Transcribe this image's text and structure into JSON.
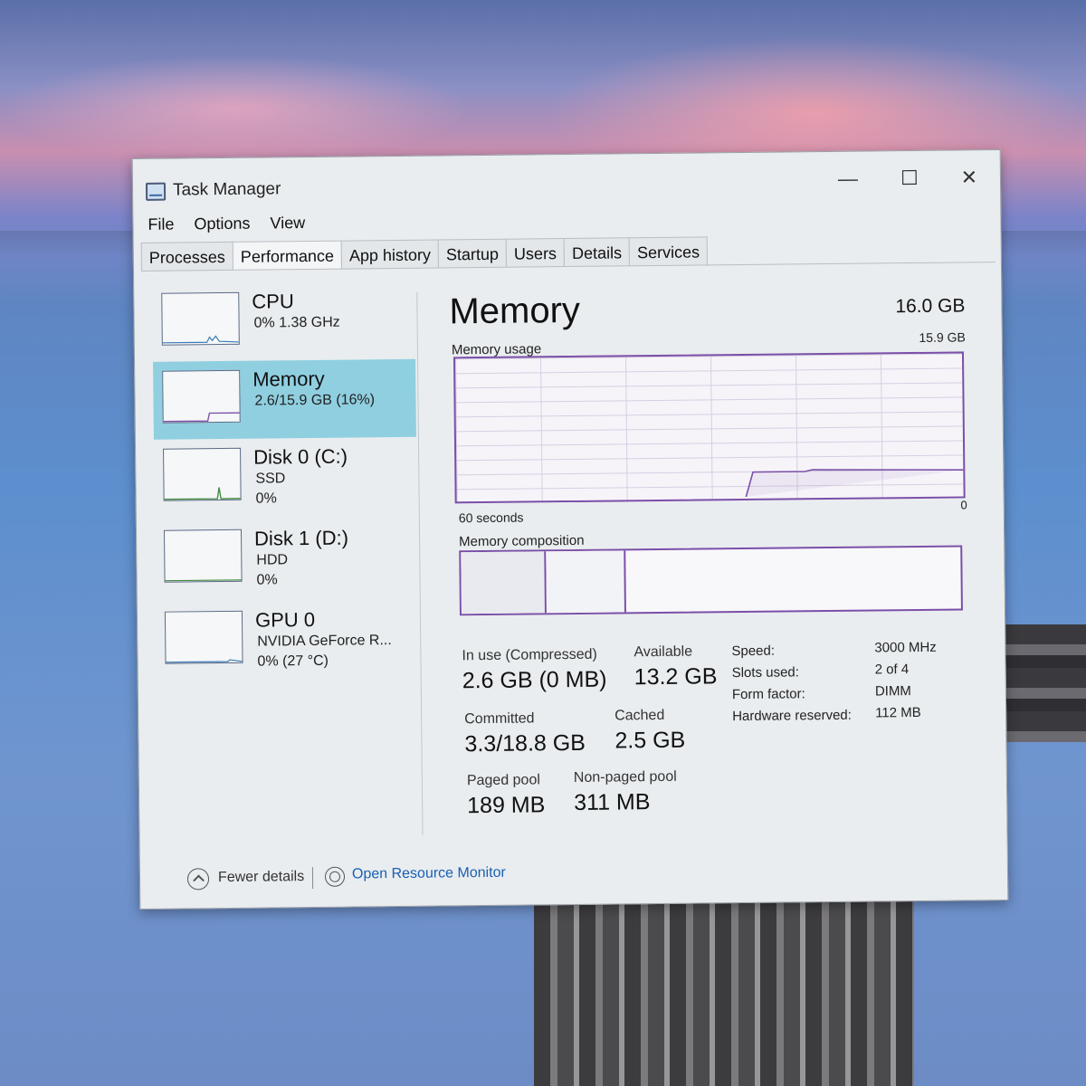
{
  "window": {
    "title": "Task Manager",
    "minimize": "—",
    "maximize": "☐",
    "close": "✕"
  },
  "menu": [
    "File",
    "Options",
    "View"
  ],
  "tabs": [
    "Processes",
    "Performance",
    "App history",
    "Startup",
    "Users",
    "Details",
    "Services"
  ],
  "active_tab": "Performance",
  "sidebar": {
    "items": [
      {
        "title": "CPU",
        "sub1": "0% 1.38 GHz",
        "sub2": ""
      },
      {
        "title": "Memory",
        "sub1": "2.6/15.9 GB (16%)",
        "sub2": ""
      },
      {
        "title": "Disk 0 (C:)",
        "sub1": "SSD",
        "sub2": "0%"
      },
      {
        "title": "Disk 1 (D:)",
        "sub1": "HDD",
        "sub2": "0%"
      },
      {
        "title": "GPU 0",
        "sub1": "NVIDIA GeForce R...",
        "sub2": "0% (27 °C)"
      }
    ]
  },
  "main": {
    "title": "Memory",
    "total": "16.0 GB",
    "usage_label": "Memory usage",
    "usage_max": "15.9 GB",
    "seconds_label": "60 seconds",
    "zero_label": "0",
    "composition_label": "Memory composition",
    "stats": {
      "in_use_label": "In use (Compressed)",
      "in_use_value": "2.6 GB (0 MB)",
      "available_label": "Available",
      "available_value": "13.2 GB",
      "committed_label": "Committed",
      "committed_value": "3.3/18.8 GB",
      "cached_label": "Cached",
      "cached_value": "2.5 GB",
      "paged_label": "Paged pool",
      "paged_value": "189 MB",
      "nonpaged_label": "Non-paged pool",
      "nonpaged_value": "311 MB"
    },
    "specs": [
      {
        "key": "Speed:",
        "value": "3000 MHz"
      },
      {
        "key": "Slots used:",
        "value": "2 of 4"
      },
      {
        "key": "Form factor:",
        "value": "DIMM"
      },
      {
        "key": "Hardware reserved:",
        "value": "112 MB"
      }
    ]
  },
  "footer": {
    "fewer_details": "Fewer details",
    "resource_monitor": "Open Resource Monitor"
  },
  "colors": {
    "memory_accent": "#7b4fa8",
    "selected_bg": "#8fcfe0",
    "link": "#1a5fb4"
  }
}
